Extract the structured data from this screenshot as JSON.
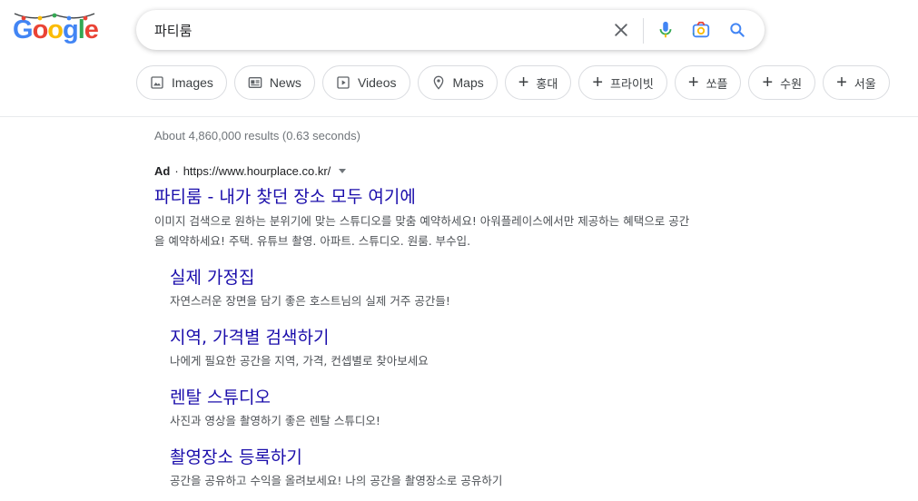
{
  "logo": {
    "letters": [
      "G",
      "o",
      "o",
      "g",
      "l",
      "e"
    ],
    "colors": [
      "#4285f4",
      "#ea4335",
      "#fbbc05",
      "#4285f4",
      "#34a853",
      "#ea4335"
    ]
  },
  "search": {
    "query": "파티룸",
    "clear_icon": "close-icon",
    "voice_icon": "mic-icon",
    "lens_icon": "camera-icon",
    "search_icon": "search-icon"
  },
  "chips": [
    {
      "label": "Images",
      "icon": "image-icon"
    },
    {
      "label": "News",
      "icon": "news-icon"
    },
    {
      "label": "Videos",
      "icon": "video-icon"
    },
    {
      "label": "Maps",
      "icon": "pin-icon"
    },
    {
      "label": "홍대",
      "icon": "plus-icon"
    },
    {
      "label": "프라이빗",
      "icon": "plus-icon"
    },
    {
      "label": "쏘플",
      "icon": "plus-icon"
    },
    {
      "label": "수원",
      "icon": "plus-icon"
    },
    {
      "label": "서울",
      "icon": "plus-icon"
    }
  ],
  "stats": "About 4,860,000 results (0.63 seconds)",
  "ad": {
    "label": "Ad",
    "separator": "·",
    "url": "https://www.hourplace.co.kr/",
    "title": "파티룸 - 내가 찾던 장소 모두 여기에",
    "description": "이미지 검색으로 원하는 분위기에 맞는 스튜디오를 맞춤 예약하세요! 아워플레이스에서만 제공하는 혜택으로 공간을 예약하세요! 주택. 유튜브 촬영. 아파트. 스튜디오. 원룸. 부수입.",
    "sitelinks": [
      {
        "title": "실제 가정집",
        "desc": "자연스러운 장면을 담기 좋은 호스트님의 실제 거주 공간들!"
      },
      {
        "title": "지역, 가격별 검색하기",
        "desc": "나에게 필요한 공간을 지역, 가격, 컨셉별로 찾아보세요"
      },
      {
        "title": "렌탈 스튜디오",
        "desc": "사진과 영상을 촬영하기 좋은 렌탈 스튜디오!"
      },
      {
        "title": "촬영장소 등록하기",
        "desc": "공간을 공유하고 수익을 올려보세요! 나의 공간을 촬영장소로 공유하기"
      }
    ]
  }
}
